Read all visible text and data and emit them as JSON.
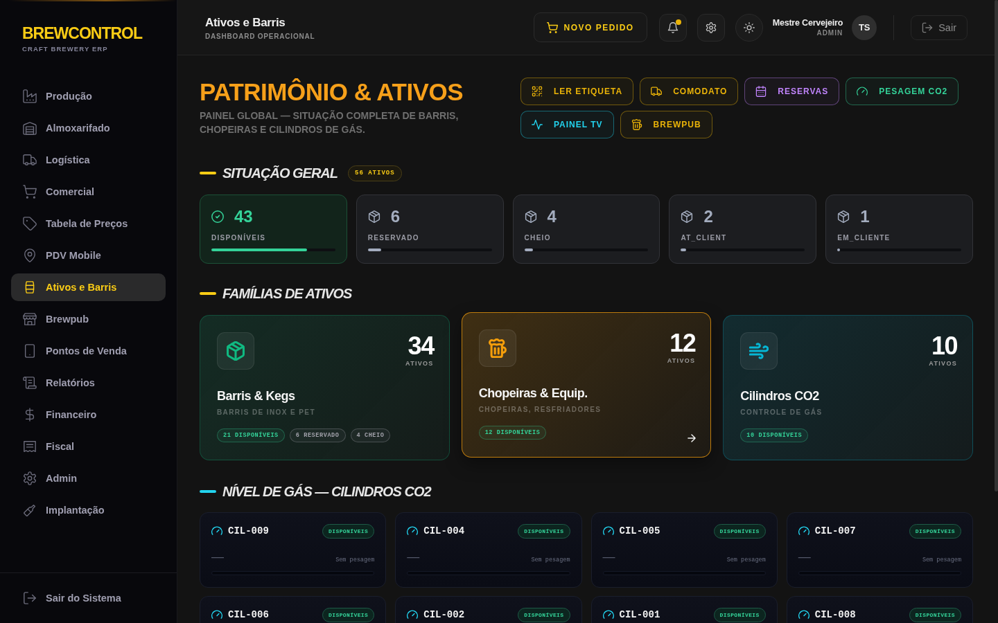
{
  "sidebar": {
    "logo": "BREWCONTROL",
    "tagline": "CRAFT BREWERY ERP",
    "items": [
      {
        "label": "Produção",
        "selected": false
      },
      {
        "label": "Almoxarifado",
        "selected": false
      },
      {
        "label": "Logística",
        "selected": false
      },
      {
        "label": "Comercial",
        "selected": false
      },
      {
        "label": "Tabela de Preços",
        "selected": false
      },
      {
        "label": "PDV Mobile",
        "selected": false
      },
      {
        "label": "Ativos e Barris",
        "selected": true
      },
      {
        "label": "Brewpub",
        "selected": false
      },
      {
        "label": "Pontos de Venda",
        "selected": false
      },
      {
        "label": "Relatórios",
        "selected": false
      },
      {
        "label": "Financeiro",
        "selected": false
      },
      {
        "label": "Fiscal",
        "selected": false
      },
      {
        "label": "Admin",
        "selected": false
      },
      {
        "label": "Implantação",
        "selected": false
      }
    ],
    "logout": "Sair do Sistema"
  },
  "header": {
    "title": "Ativos e Barris",
    "subtitle": "DASHBOARD OPERACIONAL",
    "new_order_button": "NOVO PEDIDO",
    "notifications_unread": true,
    "user": {
      "name": "Mestre Cervejeiro",
      "role": "ADMIN",
      "initials": "TS"
    },
    "logout_button": "Sair"
  },
  "hero": {
    "title": "PATRIMÔNIO & ATIVOS",
    "subtitle": "PAINEL GLOBAL — SITUAÇÃO COMPLETA DE BARRIS, CHOPEIRAS E CILINDROS DE GÁS.",
    "actions": [
      {
        "label": "LER ETIQUETA",
        "color": "#eab308"
      },
      {
        "label": "COMODATO",
        "color": "#eab308"
      },
      {
        "label": "RESERVAS",
        "color": "#c084fc"
      },
      {
        "label": "PESAGEM CO2",
        "color": "#34d399"
      },
      {
        "label": "PAINEL TV",
        "color": "#22d3ee"
      },
      {
        "label": "BREWPUB",
        "color": "#eab308"
      }
    ]
  },
  "overview": {
    "title": "SITUAÇÃO GERAL",
    "badge": "56 ATIVOS",
    "stats": [
      {
        "kind": "available",
        "value": "43",
        "label": "DISPONÍVEIS",
        "level": 0.77,
        "color": "#34d399"
      },
      {
        "kind": "status",
        "value": "6",
        "label": "RESERVADO",
        "level": 0.11,
        "color": "#a3acbe"
      },
      {
        "kind": "status",
        "value": "4",
        "label": "CHEIO",
        "level": 0.07,
        "color": "#a3acbe"
      },
      {
        "kind": "status",
        "value": "2",
        "label": "AT_CLIENT",
        "level": 0.04,
        "color": "#a3acbe"
      },
      {
        "kind": "status",
        "value": "1",
        "label": "EM_CLIENTE",
        "level": 0.02,
        "color": "#a3acbe"
      }
    ]
  },
  "families": {
    "title": "FAMÍLIAS DE ATIVOS",
    "items": [
      {
        "count": "34",
        "count_label": "ATIVOS",
        "name": "Barris & Kegs",
        "description": "BARRIS DE INOX E PET",
        "color": "#10b981",
        "selected": false,
        "chips": [
          {
            "label": "21 DISPONÍVEIS",
            "color": "#34d399"
          },
          {
            "label": "6 RESERVADO",
            "color": "#a1a1aa"
          },
          {
            "label": "4 CHEIO",
            "color": "#a1a1aa"
          }
        ]
      },
      {
        "count": "12",
        "count_label": "ATIVOS",
        "name": "Chopeiras & Equip.",
        "description": "CHOPEIRAS, RESFRIADORES",
        "color": "#f59e0b",
        "selected": true,
        "chips": [
          {
            "label": "12 DISPONÍVEIS",
            "color": "#34d399"
          }
        ]
      },
      {
        "count": "10",
        "count_label": "ATIVOS",
        "name": "Cilindros CO2",
        "description": "CONTROLE DE GÁS",
        "color": "#06b6d4",
        "selected": false,
        "chips": [
          {
            "label": "10 DISPONÍVEIS",
            "color": "#34d399"
          }
        ]
      }
    ]
  },
  "gas_levels": {
    "title": "NÍVEL DE GÁS — CILINDROS CO2",
    "cylinders": [
      {
        "code": "CIL-009",
        "status": "DISPONÍVEIS",
        "reading": "—",
        "note": "Sem pesagem"
      },
      {
        "code": "CIL-004",
        "status": "DISPONÍVEIS",
        "reading": "—",
        "note": "Sem pesagem"
      },
      {
        "code": "CIL-005",
        "status": "DISPONÍVEIS",
        "reading": "—",
        "note": "Sem pesagem"
      },
      {
        "code": "CIL-007",
        "status": "DISPONÍVEIS",
        "reading": "—",
        "note": "Sem pesagem"
      },
      {
        "code": "CIL-006",
        "status": "DISPONÍVEIS"
      },
      {
        "code": "CIL-002",
        "status": "DISPONÍVEIS"
      },
      {
        "code": "CIL-001",
        "status": "DISPONÍVEIS"
      },
      {
        "code": "CIL-008",
        "status": "DISPONÍVEIS"
      }
    ]
  }
}
